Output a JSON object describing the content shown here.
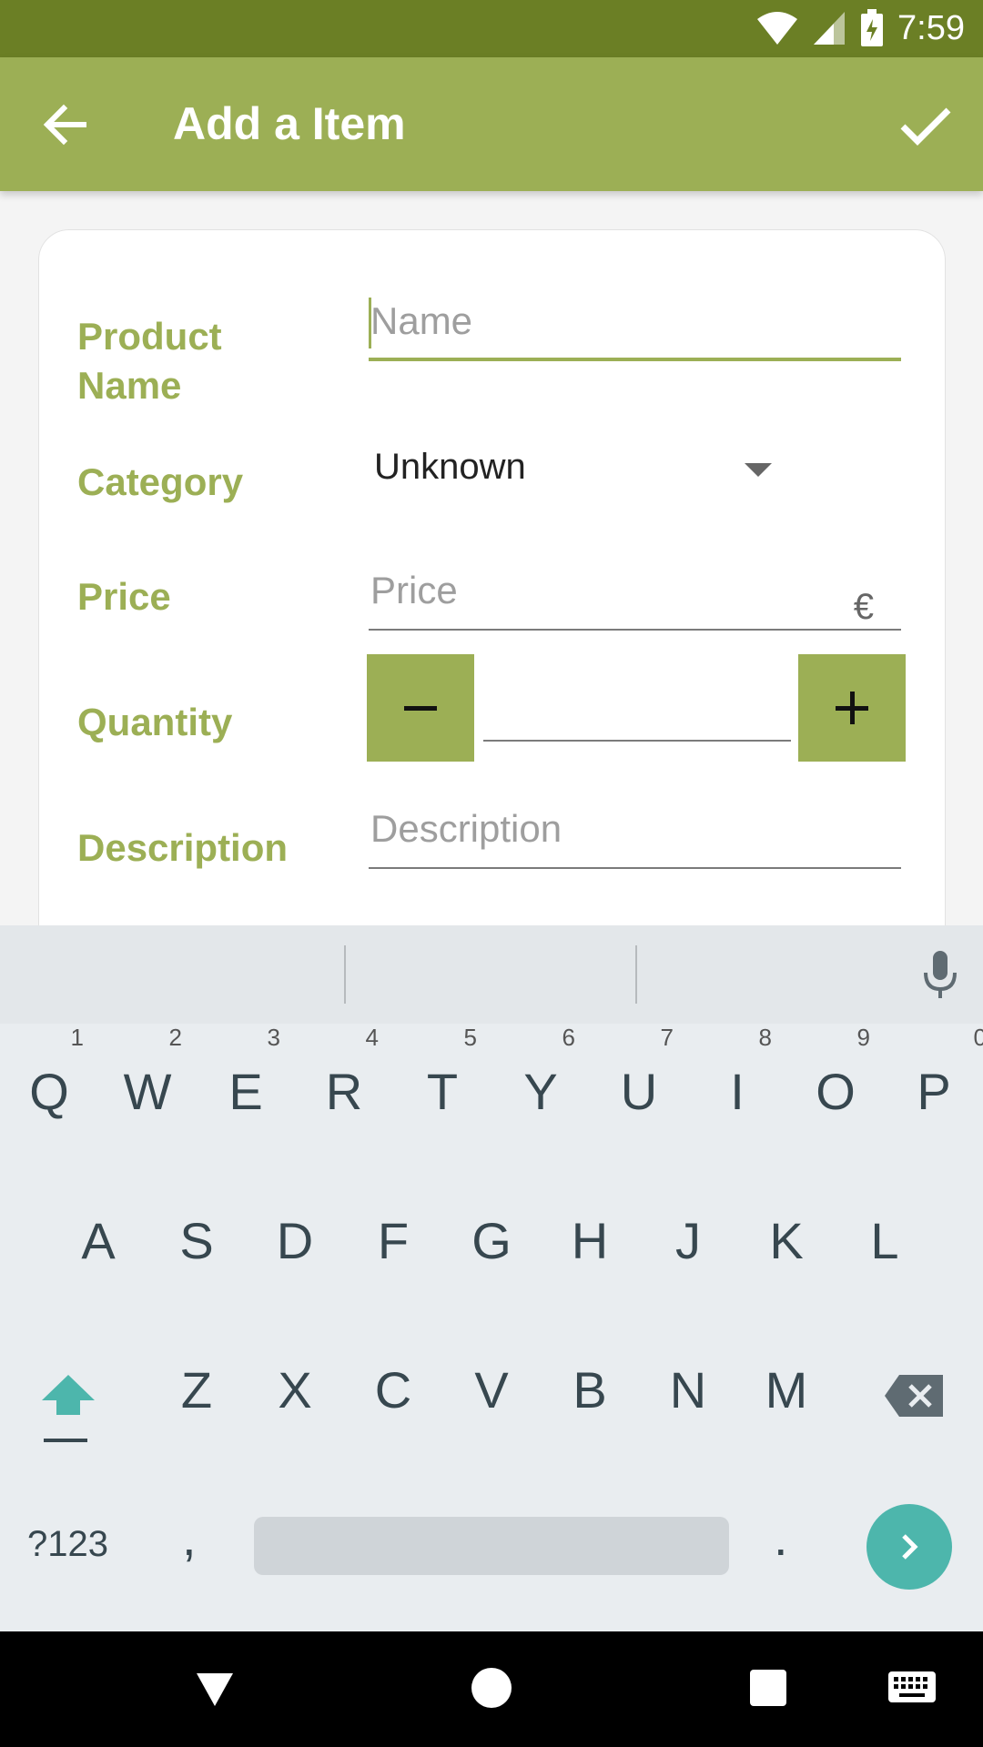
{
  "status_bar": {
    "time": "7:59",
    "icons": [
      "wifi-icon",
      "signal-icon",
      "battery-charging-icon"
    ]
  },
  "app_bar": {
    "title": "Add a Item",
    "back_icon": "arrow-back-icon",
    "confirm_icon": "check-icon",
    "color": "#9caf55",
    "status_color": "#6b7f25"
  },
  "form": {
    "product_name": {
      "label_line1": "Product",
      "label_line2": "Name",
      "placeholder": "Name",
      "value": ""
    },
    "category": {
      "label": "Category",
      "value": "Unknown"
    },
    "price": {
      "label": "Price",
      "placeholder": "Price",
      "currency": "€",
      "value": ""
    },
    "quantity": {
      "label": "Quantity",
      "decrement": "−",
      "increment": "+",
      "value": ""
    },
    "description": {
      "label": "Description",
      "placeholder": "Description",
      "value": ""
    }
  },
  "keyboard": {
    "row1": [
      {
        "key": "Q",
        "hint": "1"
      },
      {
        "key": "W",
        "hint": "2"
      },
      {
        "key": "E",
        "hint": "3"
      },
      {
        "key": "R",
        "hint": "4"
      },
      {
        "key": "T",
        "hint": "5"
      },
      {
        "key": "Y",
        "hint": "6"
      },
      {
        "key": "U",
        "hint": "7"
      },
      {
        "key": "I",
        "hint": "8"
      },
      {
        "key": "O",
        "hint": "9"
      },
      {
        "key": "P",
        "hint": "0"
      }
    ],
    "row2": [
      "A",
      "S",
      "D",
      "F",
      "G",
      "H",
      "J",
      "K",
      "L"
    ],
    "row3": [
      "Z",
      "X",
      "C",
      "V",
      "B",
      "N",
      "M"
    ],
    "symbols": "?123",
    "comma": ",",
    "period": ".",
    "accent": "#4db6ac"
  },
  "nav_bar": {
    "icons": [
      "nav-back-icon",
      "nav-home-icon",
      "nav-recents-icon",
      "keyboard-switch-icon"
    ]
  }
}
